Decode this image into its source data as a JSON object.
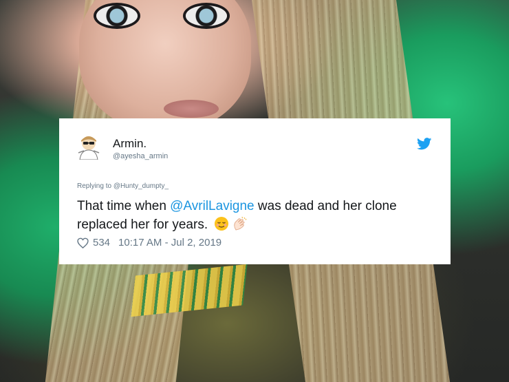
{
  "tweet": {
    "display_name": "Armin.",
    "handle": "@ayesha_armin",
    "replying_prefix": "Replying to ",
    "replying_to": "@Hunty_dumpty_",
    "text_before_mention": "That time when ",
    "mention": "@AvrilLavigne",
    "text_after_mention": " was dead and her clone replaced her for years.",
    "like_count": "534",
    "timestamp": "10:17 AM - Jul 2, 2019"
  },
  "icons": {
    "brand": "twitter-bird-icon",
    "like": "heart-icon",
    "emoji_1": "relieved-face-emoji",
    "emoji_2": "clapping-hands-emoji"
  },
  "colors": {
    "link": "#1b95e0",
    "text_primary": "#14171a",
    "text_secondary": "#657786",
    "card_background": "#ffffff"
  }
}
